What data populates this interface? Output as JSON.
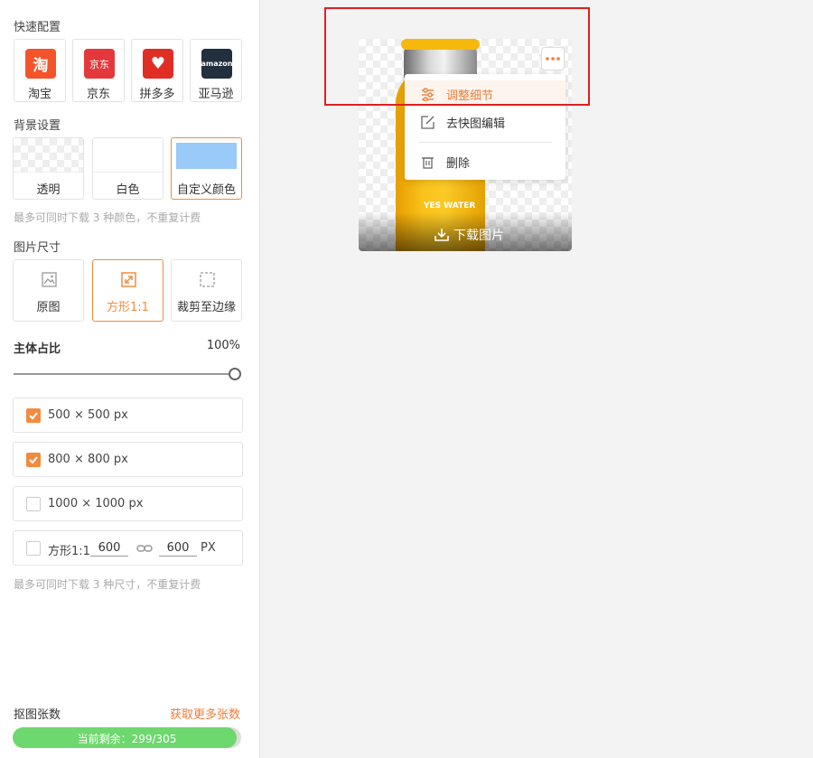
{
  "sidebar": {
    "quick_config_title": "快速配置",
    "platforms": [
      {
        "label": "淘宝",
        "glyph": "淘",
        "color": "#f4542a"
      },
      {
        "label": "京东",
        "glyph": "京东",
        "color": "#e4393c"
      },
      {
        "label": "拼多多",
        "glyph": "♥",
        "color": "#e02e24"
      },
      {
        "label": "亚马逊",
        "glyph": "amazon",
        "color": "#232f3e"
      }
    ],
    "background_title": "背景设置",
    "backgrounds": [
      {
        "label": "透明"
      },
      {
        "label": "白色"
      },
      {
        "label": "自定义颜色",
        "color": "#99caf8"
      }
    ],
    "background_hint": "最多可同时下载 3 种颜色，不重复计费",
    "size_title": "图片尺寸",
    "sizes": [
      {
        "label": "原图",
        "icon": "image-icon"
      },
      {
        "label": "方形1:1",
        "icon": "expand-icon"
      },
      {
        "label": "裁剪至边缘",
        "icon": "crop-edge-icon"
      }
    ],
    "ratio_title": "主体占比",
    "ratio_value": "100%",
    "ratio_level": 1.0,
    "dimensions": [
      {
        "label": "500 × 500 px",
        "checked": true
      },
      {
        "label": "800 × 800 px",
        "checked": true
      },
      {
        "label": "1000 × 1000 px",
        "checked": false
      }
    ],
    "custom_size": {
      "label": "方形1:1",
      "width": "600",
      "height": "600",
      "unit": "PX",
      "checked": false
    },
    "size_hint": "最多可同时下载 3 种尺寸，不重复计费",
    "count_title": "抠图张数",
    "more_link": "获取更多张数",
    "progress_text": "当前剩余：299/305",
    "progress_fraction": 0.98
  },
  "card": {
    "brand": "YES WATER",
    "download_label": "下载图片"
  },
  "menu": {
    "items": [
      {
        "label": "调整细节",
        "icon": "sliders-icon"
      },
      {
        "label": "去快图编辑",
        "icon": "edit-icon"
      },
      {
        "label": "删除",
        "icon": "trash-icon"
      }
    ]
  },
  "colors": {
    "accent": "#f07c3a",
    "highlight": "#e02020",
    "progress": "#6dd86d"
  }
}
